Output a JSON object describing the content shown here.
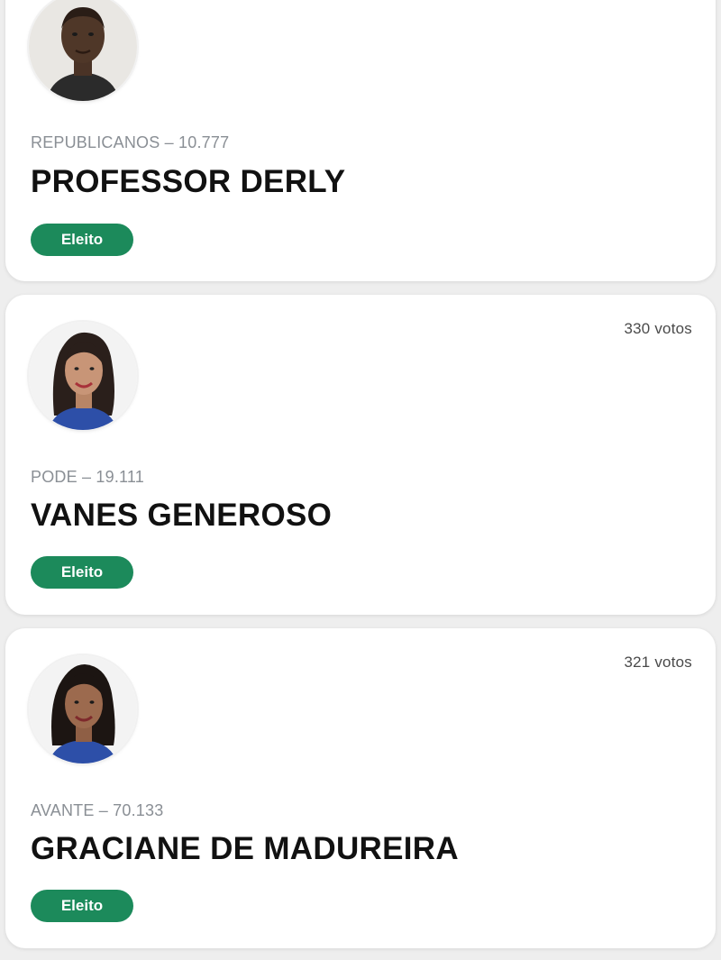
{
  "candidates": [
    {
      "party_line": "REPUBLICANOS – 10.777",
      "name": "PROFESSOR DERLY",
      "status": "Eleito",
      "votes": "",
      "photo_icon": "candidate-photo-icon"
    },
    {
      "party_line": "PODE – 19.111",
      "name": "VANES GENEROSO",
      "status": "Eleito",
      "votes": "330 votos",
      "photo_icon": "candidate-photo-icon"
    },
    {
      "party_line": "AVANTE – 70.133",
      "name": "GRACIANE DE MADUREIRA",
      "status": "Eleito",
      "votes": "321 votos",
      "photo_icon": "candidate-photo-icon"
    }
  ],
  "colors": {
    "badge": "#1c8a5b",
    "party_text": "#8a8f95",
    "name_text": "#111111",
    "page_background": "#eeeeee"
  }
}
